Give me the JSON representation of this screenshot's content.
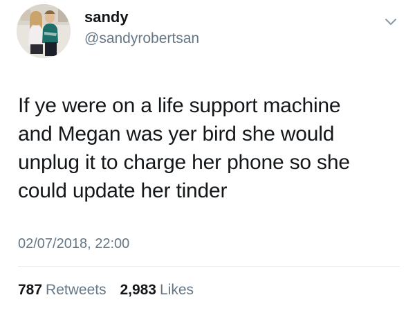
{
  "tweet": {
    "author": {
      "display_name": "sandy",
      "handle": "@sandyrobertsan"
    },
    "text_lines": [
      "If ye were on a life support machine",
      "and Megan was yer bird she would",
      "unplug it to charge her phone so she",
      "could update her tinder"
    ],
    "timestamp": "02/07/2018, 22:00",
    "stats": {
      "retweets_count": "787",
      "retweets_label": "Retweets",
      "likes_count": "2,983",
      "likes_label": "Likes"
    }
  },
  "icons": {
    "menu": "chevron-down-icon"
  },
  "colors": {
    "text_primary": "#14171a",
    "text_secondary": "#657786",
    "divider": "#e6ecf0",
    "background": "#ffffff"
  }
}
